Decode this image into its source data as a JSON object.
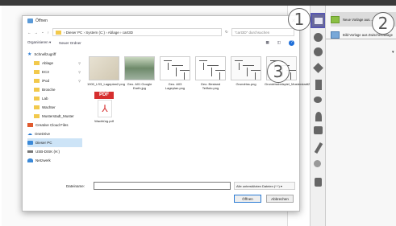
{
  "dialog": {
    "title": "Öffnen",
    "address": {
      "path": "› Dieser PC  ›  System (C:)  ›  Ablage  ›  cart3D",
      "search_placeholder": "\"cart3D\" durchsuchen"
    },
    "toolbar": {
      "organize": "Organisieren ▾",
      "new_folder": "Neuer Ordner"
    },
    "sidebar": [
      {
        "label": "Schnellzugriff",
        "icon": "star-icon"
      },
      {
        "label": "Ablage",
        "icon": "folder-icon",
        "indent": true,
        "pinned": true
      },
      {
        "label": "EC3",
        "icon": "folder-icon",
        "indent": true,
        "pinned": true
      },
      {
        "label": "iPod",
        "icon": "folder-icon",
        "indent": true,
        "pinned": true
      },
      {
        "label": "Brosche",
        "icon": "folder-icon",
        "indent": true
      },
      {
        "label": "Lab",
        "icon": "folder-icon",
        "indent": true
      },
      {
        "label": "Wachter",
        "icon": "folder-icon",
        "indent": true
      },
      {
        "label": "Musterstadt_Muster",
        "icon": "folder-icon",
        "indent": true
      },
      {
        "label": "Creative Cloud Files",
        "icon": "cloud-folder-icon"
      },
      {
        "label": "OneDrive",
        "icon": "cloud-icon"
      },
      {
        "label": "Dieser PC",
        "icon": "pc-icon",
        "selected": true
      },
      {
        "label": "USB-DISK (H:)",
        "icon": "drive-icon"
      },
      {
        "label": "Netzwerk",
        "icon": "network-icon"
      }
    ],
    "files": [
      {
        "name": "1000_LS3_Lageplan2.png",
        "thumb": "t1"
      },
      {
        "name": "Geo. A01 Google Earth.jpg",
        "thumb": "t2"
      },
      {
        "name": "Geo. A03 Lageplan.png",
        "thumb": "t3"
      },
      {
        "name": "Geo. Bestand Teilfoto.png",
        "thumb": "t4"
      },
      {
        "name": "Grundriss.png",
        "thumb": "t5"
      },
      {
        "name": "Grundrissbeispiel_Musterstadt2009.jpg",
        "thumb": "t6"
      },
      {
        "name": "Wachtürg.pdf",
        "thumb": "pdf"
      }
    ],
    "filename_label": "Dateiname:",
    "filetype": "Alle unterstützten Dateien (*.*)  ▾",
    "open_label": "Öffnen",
    "cancel_label": "Abbrechen"
  },
  "badges": [
    "1",
    "2",
    "3"
  ],
  "panel": {
    "items": [
      {
        "label": "Neue Vorlage aus..."
      },
      {
        "label": "Bild-Vorlage aus Zwischenablage"
      }
    ],
    "dropdown_glyph": "▾"
  },
  "colors": {
    "accent": "#5757b0",
    "selection": "#cde4f7",
    "folder": "#f2c94c",
    "pdf": "#d62e2e"
  }
}
